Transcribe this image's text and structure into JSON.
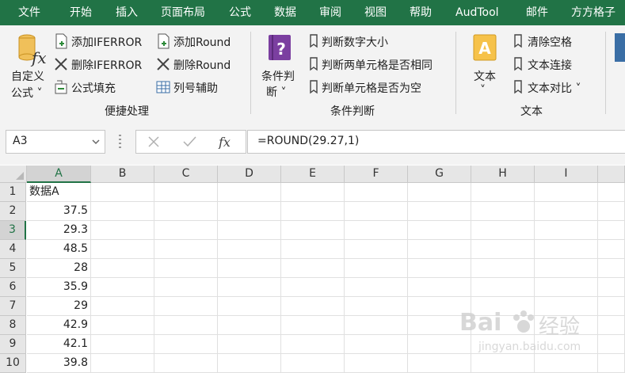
{
  "menubar": {
    "tabs": [
      "文件",
      "开始",
      "插入",
      "页面布局",
      "公式",
      "数据",
      "审阅",
      "视图",
      "帮助",
      "AudTool",
      "邮件",
      "方方格子"
    ]
  },
  "ribbon": {
    "custom_formula": {
      "line1": "自定义",
      "line2": "公式 ˅"
    },
    "add_iferror": "添加IFERROR",
    "del_iferror": "删除IFERROR",
    "formula_fill": "公式填充",
    "add_round": "添加Round",
    "del_round": "删除Round",
    "col_helper": "列号辅助",
    "group1_label": "便捷处理",
    "condition": {
      "line1": "条件判",
      "line2": "断 ˅"
    },
    "judge_num_size": "判断数字大小",
    "judge_two_cells_same": "判断两单元格是否相同",
    "judge_cell_empty": "判断单元格是否为空",
    "group2_label": "条件判断",
    "text": {
      "line1": "文本",
      "line2": "˅"
    },
    "clear_spaces": "清除空格",
    "text_concat": "文本连接",
    "text_compare": "文本对比 ˅",
    "group3_label": "文本"
  },
  "formula_bar": {
    "namebox": "A3",
    "formula": "=ROUND(29.27,1)"
  },
  "sheet": {
    "columns": [
      "A",
      "B",
      "C",
      "D",
      "E",
      "F",
      "G",
      "H",
      "I"
    ],
    "selected_column": "A",
    "selected_row": "3",
    "rows": [
      {
        "num": "1",
        "a": "数据A"
      },
      {
        "num": "2",
        "a": "37.5"
      },
      {
        "num": "3",
        "a": "29.3"
      },
      {
        "num": "4",
        "a": "48.5"
      },
      {
        "num": "5",
        "a": "28"
      },
      {
        "num": "6",
        "a": "35.9"
      },
      {
        "num": "7",
        "a": "29"
      },
      {
        "num": "8",
        "a": "42.9"
      },
      {
        "num": "9",
        "a": "42.1"
      },
      {
        "num": "10",
        "a": "39.8"
      }
    ]
  },
  "watermark": {
    "brand": "Bai",
    "brand2": "经验",
    "url": "jingyan.baidu.com"
  },
  "colors": {
    "accent": "#217346",
    "ribbon_bg": "#f3f3f3",
    "header_bg": "#e6e6e6"
  }
}
